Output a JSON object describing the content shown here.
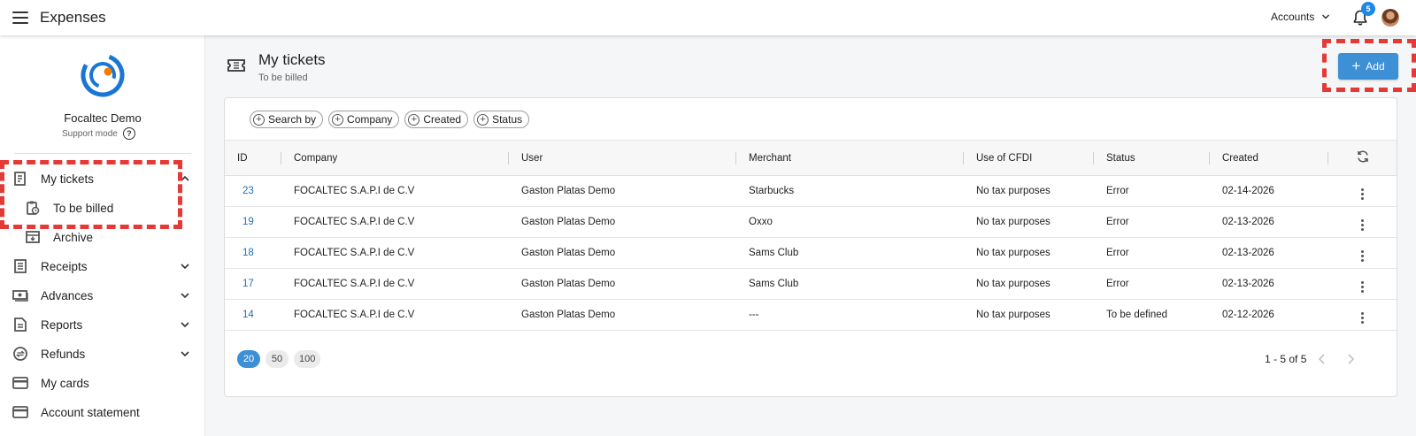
{
  "header": {
    "app_title": "Expenses",
    "accounts_label": "Accounts",
    "notification_count": "5"
  },
  "sidebar": {
    "org_name": "Focaltec Demo",
    "support_mode": "Support mode",
    "help_glyph": "?",
    "items": [
      {
        "label": "My tickets",
        "icon": "receipt-icon",
        "expanded": true
      },
      {
        "label": "To be billed",
        "icon": "clipboard-clock-icon"
      },
      {
        "label": "Archive",
        "icon": "archive-icon"
      },
      {
        "label": "Receipts",
        "icon": "receipts-icon"
      },
      {
        "label": "Advances",
        "icon": "cash-icon"
      },
      {
        "label": "Reports",
        "icon": "report-icon"
      },
      {
        "label": "Refunds",
        "icon": "refund-icon"
      },
      {
        "label": "My cards",
        "icon": "card-icon"
      },
      {
        "label": "Account statement",
        "icon": "statement-icon"
      }
    ]
  },
  "page": {
    "title": "My tickets",
    "subtitle": "To be billed",
    "add_label": "Add",
    "add_glyph": "+"
  },
  "filters": {
    "glyph": "+",
    "items": [
      "Search by",
      "Company",
      "Created",
      "Status"
    ]
  },
  "table": {
    "columns": [
      "ID",
      "Company",
      "User",
      "Merchant",
      "Use of CFDI",
      "Status",
      "Created"
    ],
    "rows": [
      [
        "23",
        "FOCALTEC S.A.P.I de C.V",
        "Gaston Platas Demo",
        "Starbucks",
        "No tax purposes",
        "Error",
        "02-14-2026"
      ],
      [
        "19",
        "FOCALTEC S.A.P.I de C.V",
        "Gaston Platas Demo",
        "Oxxo",
        "No tax purposes",
        "Error",
        "02-13-2026"
      ],
      [
        "18",
        "FOCALTEC S.A.P.I de C.V",
        "Gaston Platas Demo",
        "Sams Club",
        "No tax purposes",
        "Error",
        "02-13-2026"
      ],
      [
        "17",
        "FOCALTEC S.A.P.I de C.V",
        "Gaston Platas Demo",
        "Sams Club",
        "No tax purposes",
        "Error",
        "02-13-2026"
      ],
      [
        "14",
        "FOCALTEC S.A.P.I de C.V",
        "Gaston Platas Demo",
        "---",
        "No tax purposes",
        "To be defined",
        "02-12-2026"
      ]
    ]
  },
  "pagination": {
    "page_sizes": [
      "20",
      "50",
      "100"
    ],
    "selected_size": "20",
    "info": "1 - 5 of 5"
  },
  "colors": {
    "primary": "#3d8fd6",
    "highlight": "#e53935",
    "link": "#1e6fb8"
  }
}
